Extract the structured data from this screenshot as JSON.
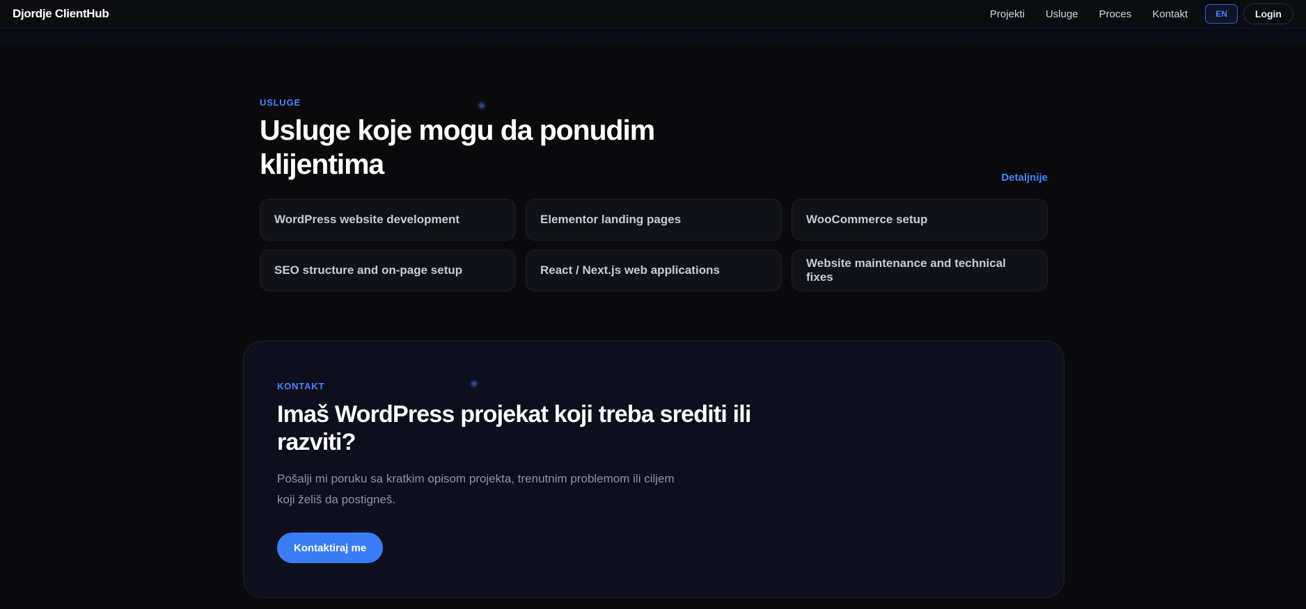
{
  "header": {
    "brand": "Djordje ClientHub",
    "nav": [
      "Projekti",
      "Usluge",
      "Proces",
      "Kontakt"
    ],
    "lang_label": "EN",
    "login_label": "Login"
  },
  "services": {
    "eyebrow": "USLUGE",
    "title": "Usluge koje mogu da ponudim klijentima",
    "details_link": "Detaljnije",
    "items": [
      "WordPress website development",
      "Elementor landing pages",
      "WooCommerce setup",
      "SEO structure and on-page setup",
      "React / Next.js web applications",
      "Website maintenance and technical fixes"
    ]
  },
  "contact": {
    "eyebrow": "KONTAKT",
    "title": "Imaš WordPress projekat koji treba srediti ili razviti?",
    "text": "Pošalji mi poruku sa kratkim opisom projekta, trenutnim problemom ili ciljem koji želiš da postigneš.",
    "cta_label": "Kontaktiraj me"
  },
  "theme": {
    "accent": "#3a7cf6",
    "accent_text": "#4b84ff",
    "background": "#0a0a0d",
    "card": "#101217"
  }
}
